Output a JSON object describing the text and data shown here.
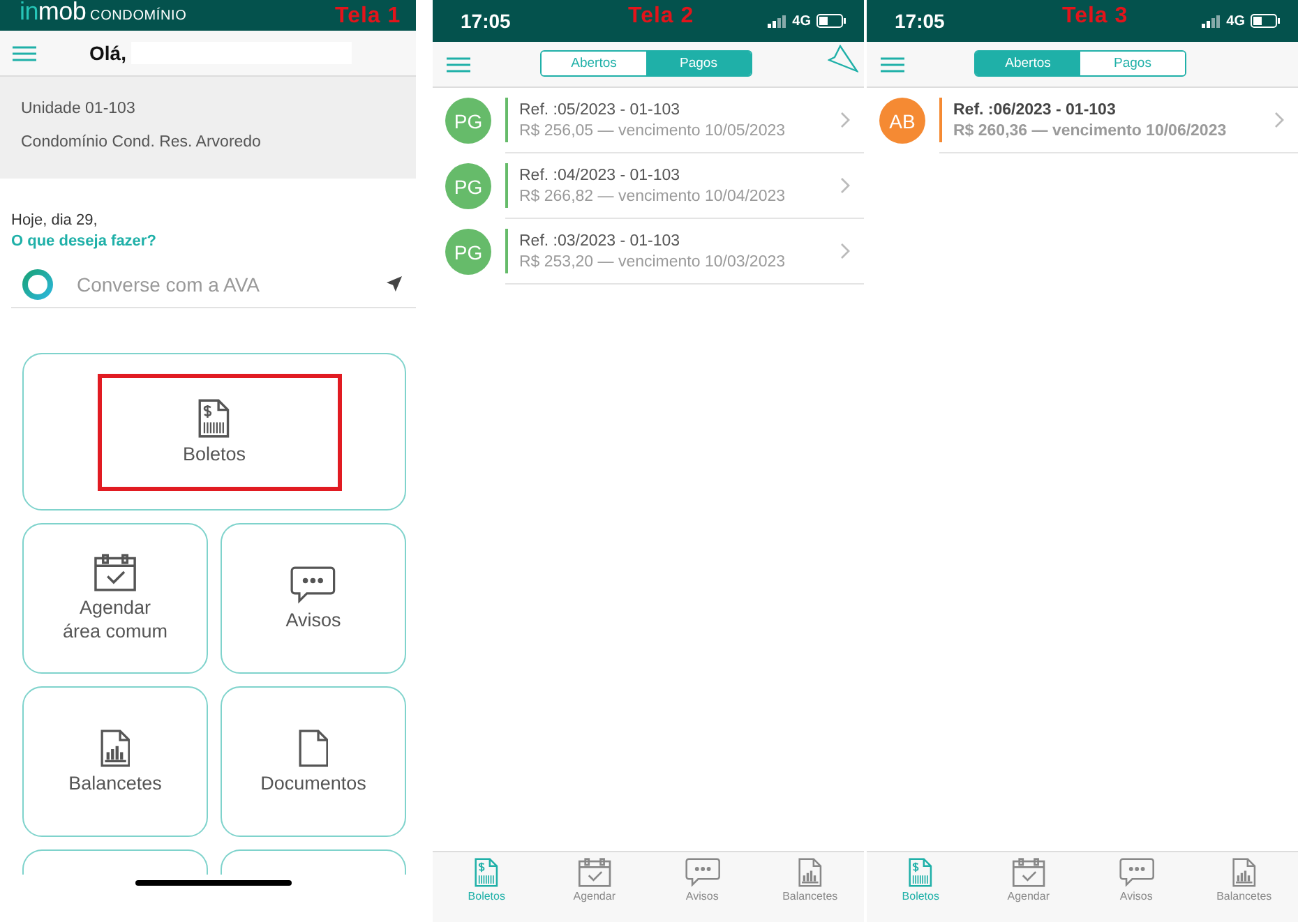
{
  "screens": [
    {
      "kind": "home",
      "label": "Tela 1",
      "brand": {
        "prefix": "in",
        "name": "mob",
        "suffix": "CONDOMÍNIO"
      },
      "greeting": "Olá,",
      "unit": "Unidade 01-103",
      "condo": "Condomínio Cond. Res. Arvoredo",
      "today": "Hoje, dia 29,",
      "question": "O que deseja fazer?",
      "chat": {
        "placeholder": "Converse com a AVA"
      },
      "tiles": [
        {
          "label": "Boletos",
          "highlighted": true
        },
        {
          "label": "Agendar área comum",
          "highlighted": false
        },
        {
          "label": "Avisos",
          "highlighted": false
        },
        {
          "label": "Balancetes",
          "highlighted": false
        },
        {
          "label": "Documentos",
          "highlighted": false
        }
      ]
    },
    {
      "kind": "list",
      "label": "Tela 2",
      "time": "17:05",
      "network": "4G",
      "segments": [
        {
          "label": "Abertos",
          "selected": false
        },
        {
          "label": "Pagos",
          "selected": true
        }
      ],
      "rows": [
        {
          "avatar": "PG",
          "color": "#66bb6a",
          "emphasized": false,
          "title": "Ref. :05/2023 - 01-103",
          "detail": "R$ 256,05 — vencimento 10/05/2023"
        },
        {
          "avatar": "PG",
          "color": "#66bb6a",
          "emphasized": false,
          "title": "Ref. :04/2023 - 01-103",
          "detail": "R$ 266,82 — vencimento 10/04/2023"
        },
        {
          "avatar": "PG",
          "color": "#66bb6a",
          "emphasized": false,
          "title": "Ref. :03/2023 - 01-103",
          "detail": "R$ 253,20 — vencimento 10/03/2023"
        }
      ],
      "tabs": [
        {
          "label": "Boletos",
          "selected": true
        },
        {
          "label": "Agendar",
          "selected": false
        },
        {
          "label": "Avisos",
          "selected": false
        },
        {
          "label": "Balancetes",
          "selected": false
        }
      ]
    },
    {
      "kind": "list",
      "label": "Tela 3",
      "time": "17:05",
      "network": "4G",
      "segments": [
        {
          "label": "Abertos",
          "selected": true
        },
        {
          "label": "Pagos",
          "selected": false
        }
      ],
      "rows": [
        {
          "avatar": "AB",
          "color": "#f58a33",
          "emphasized": true,
          "title": "Ref. :06/2023 - 01-103",
          "detail": "R$ 260,36 — vencimento 10/06/2023"
        }
      ],
      "tabs": [
        {
          "label": "Boletos",
          "selected": true
        },
        {
          "label": "Agendar",
          "selected": false
        },
        {
          "label": "Avisos",
          "selected": false
        },
        {
          "label": "Balancetes",
          "selected": false
        }
      ]
    }
  ]
}
